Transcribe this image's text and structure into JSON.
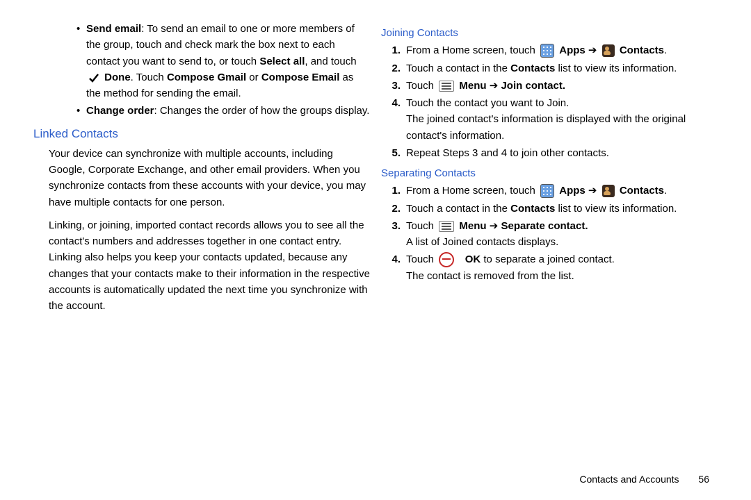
{
  "left": {
    "bullets": [
      {
        "label": "Send email",
        "text1": ": To send an email to one or more members of the group, touch and check mark the box next to each contact you want to send to, or touch ",
        "bold1": "Select all",
        "text2": ", and touch ",
        "bold2": "Done",
        "text3": ". Touch ",
        "bold3": "Compose Gmail",
        "text4": " or ",
        "bold4": "Compose Email",
        "text5": " as the method for sending the email."
      },
      {
        "label": "Change order",
        "text1": ": Changes the order of how the groups display."
      }
    ],
    "heading": "Linked Contacts",
    "para1": "Your device can synchronize with multiple accounts, including Google, Corporate Exchange, and other email providers. When you synchronize contacts from these accounts with your device, you may have multiple contacts for one person.",
    "para2": "Linking, or joining, imported contact records allows you to see all the contact's numbers and addresses together in one contact entry. Linking also helps you keep your contacts updated, because any changes that your contacts make to their information in the respective accounts is automatically updated the next time you synchronize with the account."
  },
  "right": {
    "sub1": "Joining Contacts",
    "j": {
      "s1a": "From a Home screen, touch ",
      "s1b": "Apps",
      "s1c": " ➔ ",
      "s1d": "Contacts",
      "s1e": ".",
      "s2a": "Touch a contact in the ",
      "s2b": "Contacts",
      "s2c": " list to view its information.",
      "s3a": "Touch ",
      "s3b": "Menu",
      "s3c": " ➔ ",
      "s3d": "Join contact.",
      "s4a": "Touch the contact you want to Join.",
      "s4b": "The joined contact's information is displayed with the original contact's information.",
      "s5": "Repeat Steps 3 and 4 to join other contacts."
    },
    "sub2": "Separating Contacts",
    "s": {
      "s1a": "From a Home screen, touch ",
      "s1b": "Apps",
      "s1c": " ➔ ",
      "s1d": "Contacts",
      "s1e": ".",
      "s2a": "Touch a contact in the ",
      "s2b": "Contacts",
      "s2c": " list to view its information.",
      "s3a": "Touch ",
      "s3b": "Menu",
      "s3c": " ➔ ",
      "s3d": "Separate contact.",
      "s3e": "A list of Joined contacts displays.",
      "s4a": "Touch ",
      "s4b": "OK",
      "s4c": " to separate a joined contact.",
      "s4d": "The contact is removed from the list."
    }
  },
  "footer": {
    "section": "Contacts and Accounts",
    "page": "56"
  }
}
